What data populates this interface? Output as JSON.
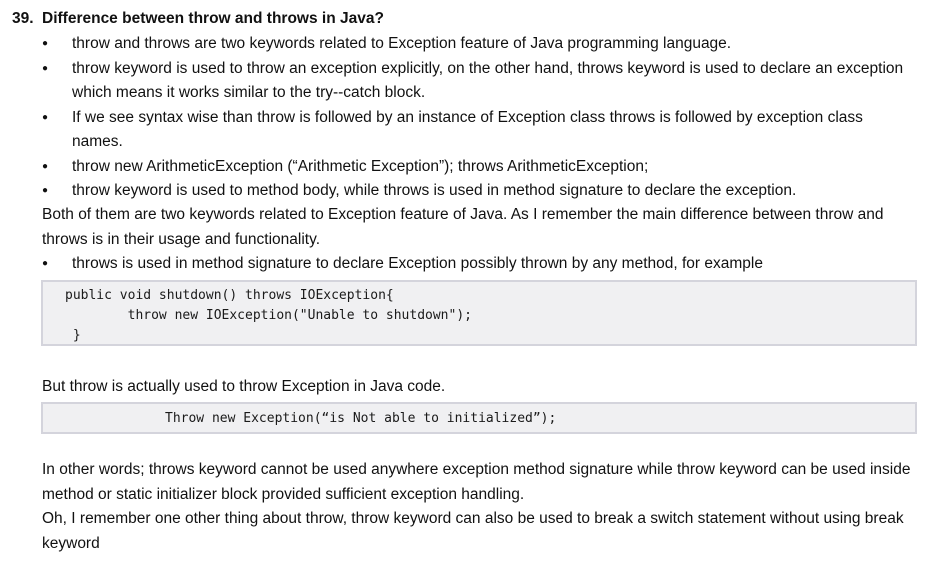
{
  "question": {
    "number": "39.",
    "title": "Difference between throw and throws in Java?"
  },
  "bullets_top": [
    "throw and throws are two keywords related to Exception feature of Java programming language.",
    "throw keyword is used to throw an exception explicitly, on the other hand, throws keyword is used to declare an exception which means it works similar to the try--catch block.",
    "If we see syntax wise than throw is followed by an instance of Exception class throws is followed by exception class names.",
    "throw new ArithmeticException (“Arithmetic Exception”); throws ArithmeticException;",
    "throw keyword is used to method body, while throws is used in method signature to declare the exception."
  ],
  "paragraph_both": "Both of them are two keywords related to Exception feature of Java.  As I remember  the main difference between throw and throws is in their usage and functionality.",
  "bullet_throws": "throws is used in method signature to declare Exception possibly thrown by any method, for example",
  "code_block_1": [
    "public void shutdown() throws IOException{",
    "        throw new IOException(\"Unable to shutdown\");",
    " }"
  ],
  "paragraph_throw_usage": "But throw is actually used to throw Exception in Java code.",
  "code_block_2": [
    "Throw new Exception(“is Not able to initialized”);"
  ],
  "paragraph_other_words": "In other words; throws keyword cannot be used anywhere exception method signature while throw keyword can be used inside method or static initializer block provided sufficient exception handling.",
  "paragraph_remember": "Oh, I remember one other thing about throw, throw keyword can also be used to break a switch statement without using break keyword"
}
